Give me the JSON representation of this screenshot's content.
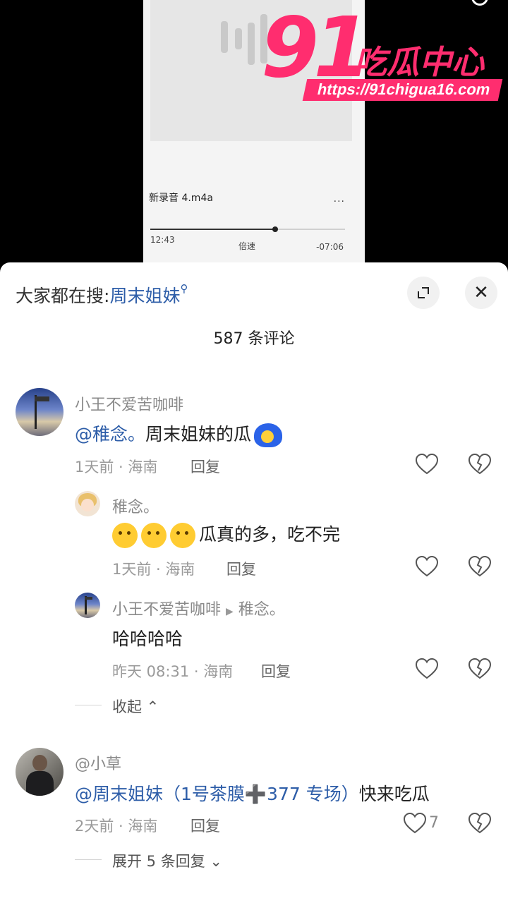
{
  "media": {
    "file_name": "新录音 4.m4a",
    "menu": "···",
    "time_elapsed": "12:43",
    "speed_label": "倍速",
    "time_remaining": "-07:06",
    "progress": 0.64
  },
  "watermark": {
    "number": "91",
    "name": "吃瓜中心",
    "url": "https://91chigua16.com"
  },
  "header": {
    "hot_prefix": "大家都在搜:",
    "hot_keyword": "周末姐妹",
    "comment_count": "587 条评论"
  },
  "icons": {
    "expand": "expand-icon",
    "close": "close-icon",
    "close_glyph": "✕",
    "like": "heart-outline-icon",
    "dislike": "broken-heart-icon"
  },
  "comments": [
    {
      "user": "小王不爱苦咖啡",
      "mention": "@稚念。",
      "text": "周末姐妹的瓜",
      "time": "1天前 · 海南",
      "reply": "回复",
      "replies": [
        {
          "user": "稚念。",
          "text": "瓜真的多，吃不完",
          "time": "1天前 · 海南",
          "reply": "回复"
        },
        {
          "user": "小王不爱苦咖啡",
          "arrow": "▶",
          "target": "稚念。",
          "text": "哈哈哈哈",
          "time": "昨天 08:31 · 海南",
          "reply": "回复"
        }
      ],
      "collapse_label": "收起 ⌃"
    },
    {
      "user": "@小草",
      "mention": "@周末姐妹（1号茶膜➕377 专场）",
      "text": "快来吃瓜",
      "time": "2天前 · 海南",
      "reply": "回复",
      "likes": "7",
      "expand_label": "展开 5 条回复 ⌄"
    }
  ]
}
